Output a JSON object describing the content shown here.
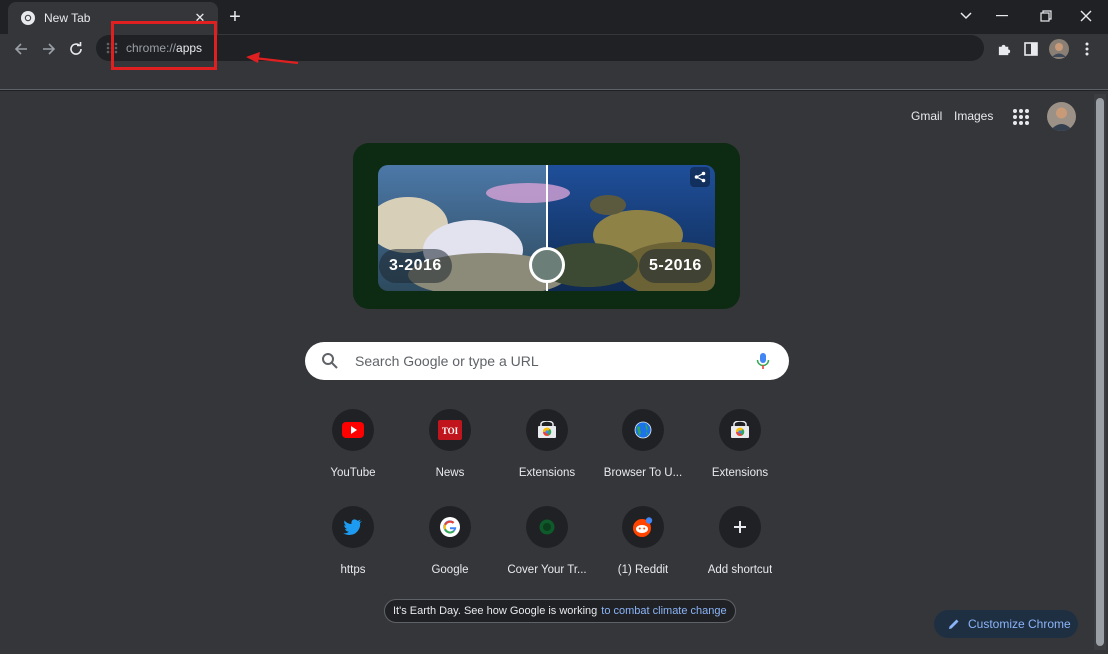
{
  "tab": {
    "title": "New Tab"
  },
  "omnibox": {
    "scheme": "chrome://",
    "path": "apps"
  },
  "top_links": {
    "gmail": "Gmail",
    "images": "Images"
  },
  "doodle": {
    "left_label": "3-2016",
    "right_label": "5-2016"
  },
  "search": {
    "placeholder": "Search Google or type a URL"
  },
  "shortcuts": [
    {
      "label": "YouTube",
      "icon": "youtube-icon"
    },
    {
      "label": "News",
      "icon": "toi-icon"
    },
    {
      "label": "Extensions",
      "icon": "chrome-web-store-icon"
    },
    {
      "label": "Browser To U...",
      "icon": "globe-icon"
    },
    {
      "label": "Extensions",
      "icon": "chrome-web-store-icon"
    },
    {
      "label": "https",
      "icon": "twitter-icon"
    },
    {
      "label": "Google",
      "icon": "google-icon"
    },
    {
      "label": "Cover Your Tr...",
      "icon": "spotify-icon"
    },
    {
      "label": "(1) Reddit",
      "icon": "reddit-icon"
    },
    {
      "label": "Add shortcut",
      "icon": "plus-icon"
    }
  ],
  "earth_day": {
    "text": "It's Earth Day. See how Google is working",
    "link": "to combat climate change"
  },
  "customize": {
    "label": "Customize Chrome"
  },
  "colors": {
    "page_bg": "#35363a",
    "accent": "#8ab4f8",
    "annotation": "#e02020"
  }
}
